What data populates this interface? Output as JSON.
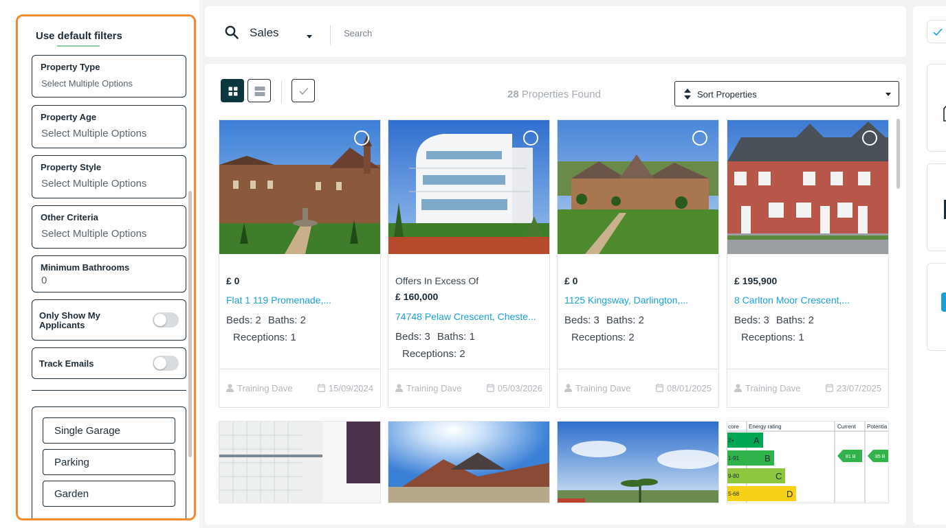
{
  "filters": {
    "title": "Use default filters",
    "property_type": {
      "label": "Property Type",
      "value": "Select Multiple Options"
    },
    "property_age": {
      "label": "Property Age",
      "value": "Select Multiple Options"
    },
    "property_style": {
      "label": "Property Style",
      "value": "Select Multiple Options"
    },
    "other_criteria": {
      "label": "Other Criteria",
      "value": "Select Multiple Options"
    },
    "min_bathrooms": {
      "label": "Minimum Bathrooms",
      "value": "0"
    },
    "only_my_applicants": {
      "label_line1": "Only Show My",
      "label_line2": "Applicants",
      "on": false
    },
    "track_emails": {
      "label": "Track Emails",
      "on": false
    },
    "amenities": [
      "Single Garage",
      "Parking",
      "Garden"
    ]
  },
  "search": {
    "category": "Sales",
    "placeholder": "Search"
  },
  "results": {
    "count": "28",
    "count_label": "Properties Found",
    "sort_label": "Sort Properties"
  },
  "cards": [
    {
      "prefix": "",
      "price": "£ 0",
      "address": "Flat 1 119 Promenade,...",
      "beds": "Beds: 2",
      "baths": "Baths: 2",
      "receptions": "Receptions: 1",
      "agent": "Training Dave",
      "date": "15/09/2024"
    },
    {
      "prefix": "Offers In Excess Of",
      "price": "£ 160,000",
      "address": "74748 Pelaw Crescent, Cheste...",
      "beds": "Beds: 3",
      "baths": "Baths: 1",
      "receptions": "Receptions: 2",
      "agent": "Training Dave",
      "date": "05/03/2026"
    },
    {
      "prefix": "",
      "price": "£ 0",
      "address": "1125 Kingsway, Darlington,...",
      "beds": "Beds: 3",
      "baths": "Baths: 2",
      "receptions": "Receptions: 2",
      "agent": "Training Dave",
      "date": "08/01/2025"
    },
    {
      "prefix": "",
      "price": "£ 195,900",
      "address": "8 Carlton Moor Crescent,...",
      "beds": "Beds: 3",
      "baths": "Baths: 2",
      "receptions": "Receptions: 1",
      "agent": "Training Dave",
      "date": "23/07/2025"
    }
  ],
  "energy": {
    "col_score": "core",
    "col_rating": "Energy rating",
    "col_current": "Current",
    "col_potential": "Potentia",
    "bands": [
      {
        "score": "2+",
        "letter": "A",
        "color": "#00a651"
      },
      {
        "score": "1-91",
        "letter": "B",
        "color": "#2fb34a"
      },
      {
        "score": "9-80",
        "letter": "C",
        "color": "#8dc63f"
      },
      {
        "score": "5-68",
        "letter": "D",
        "color": "#f7d117"
      }
    ],
    "current": "81 B",
    "potential": "85 B"
  },
  "colors": {
    "accent_orange": "#f08a2c",
    "dark_teal": "#0c3640",
    "link_blue": "#1aa0d8"
  }
}
